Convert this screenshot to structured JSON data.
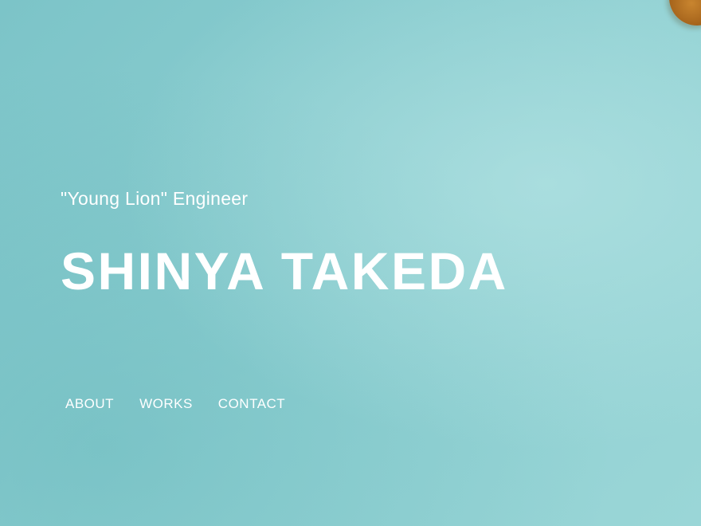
{
  "hero": {
    "tagline": "\"Young Lion\" Engineer",
    "name": "SHINYA TAKEDA"
  },
  "nav": {
    "items": [
      {
        "label": "ABOUT"
      },
      {
        "label": "WORKS"
      },
      {
        "label": "CONTACT"
      }
    ]
  },
  "colors": {
    "background": "#86c9cc",
    "text": "#ffffff",
    "corner_object": "#9b5a16"
  }
}
